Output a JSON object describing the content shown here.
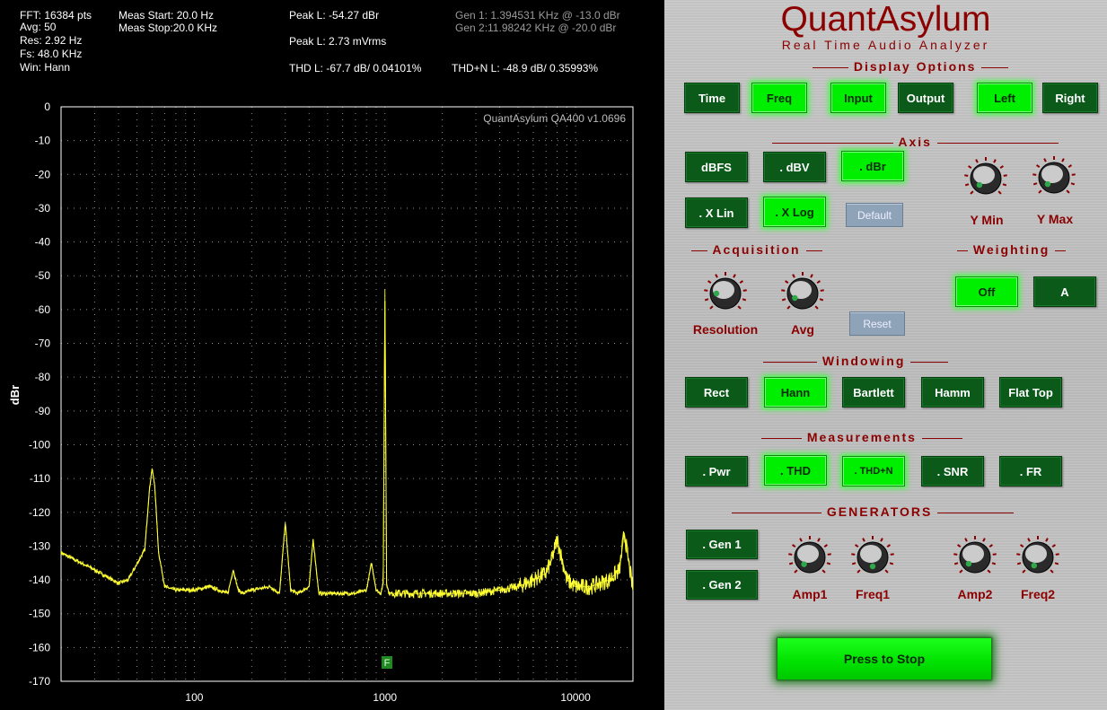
{
  "readouts": {
    "fft": "FFT: 16384 pts",
    "avg": "Avg: 50",
    "res": "Res: 2.92 Hz",
    "fs": "Fs: 48.0 KHz",
    "win": "Win: Hann",
    "meas_start": "Meas Start: 20.0 Hz",
    "meas_stop": "Meas Stop:20.0 KHz",
    "peak_dbr": "Peak L: -54.27 dBr",
    "peak_mv": "Peak L: 2.73 mVrms",
    "thd": "THD L: -67.7 dB/ 0.04101%",
    "thdn": "THD+N L: -48.9 dB/ 0.35993%",
    "gen1": "Gen 1: 1.394531 KHz @ -13.0  dBr",
    "gen2": "Gen 2:11.98242 KHz @ -20.0  dBr"
  },
  "plot": {
    "watermark": "QuantAsylum QA400 v1.0696",
    "marker": "F",
    "colors": {
      "trace": "#ffff33",
      "grid": "#d0d0d0",
      "frame": "#ffffff",
      "marker": "#1f8a1f"
    }
  },
  "chart_data": {
    "type": "line",
    "ylabel": "dBr",
    "xlabel": "",
    "x_scale": "log",
    "xlim": [
      20,
      20000
    ],
    "ylim": [
      -170,
      0
    ],
    "y_ticks": [
      "0",
      "-10",
      "-20",
      "-30",
      "-40",
      "-50",
      "-60",
      "-70",
      "-80",
      "-90",
      "-100",
      "-110",
      "-120",
      "-130",
      "-140",
      "-150",
      "-160",
      "-170"
    ],
    "x_ticks": [
      "100",
      "1000",
      "10000"
    ],
    "grid": true,
    "series": [
      {
        "x": [
          20,
          30,
          40,
          45,
          55,
          58,
          60,
          62,
          65,
          70,
          80,
          100,
          120,
          150,
          160,
          170,
          180,
          200,
          250,
          280,
          300,
          320,
          350,
          400,
          420,
          450,
          500,
          600,
          700,
          800,
          850,
          900,
          950,
          980,
          1000,
          1020,
          1050,
          1100,
          1200,
          1500,
          2000,
          3000,
          4000,
          5000,
          6000,
          7000,
          7500,
          8000,
          8500,
          9000,
          10000,
          12000,
          15000,
          17000,
          18000,
          20000
        ],
        "y": [
          -132,
          -137,
          -141,
          -140,
          -131,
          -114,
          -107,
          -112,
          -132,
          -142,
          -143,
          -143,
          -142,
          -144,
          -137,
          -143,
          -144,
          -143,
          -142,
          -144,
          -123,
          -143,
          -144,
          -142,
          -128,
          -144,
          -144,
          -144,
          -144,
          -143,
          -135,
          -143,
          -144,
          -141,
          -54,
          -141,
          -144,
          -144,
          -144,
          -144,
          -144,
          -144,
          -143,
          -142,
          -140,
          -138,
          -134,
          -128,
          -134,
          -140,
          -142,
          -142,
          -140,
          -137,
          -126,
          -143
        ]
      }
    ]
  },
  "panel": {
    "title": "QuantAsylum",
    "subtitle": "Real Time Audio Analyzer",
    "sections": {
      "display": "Display Options",
      "axis": "Axis",
      "acq": "Acquisition",
      "weight": "Weighting",
      "window": "Windowing",
      "meas": "Measurements",
      "gen": "GENERATORS"
    },
    "buttons": {
      "time": "Time",
      "freq": "Freq",
      "input": "Input",
      "output": "Output",
      "left": "Left",
      "right": "Right",
      "dbfs": "dBFS",
      "dbv": ". dBV",
      "dbr": ". dBr",
      "xlin": ". X Lin",
      "xlog": ". X Log",
      "default": "Default",
      "reset": "Reset",
      "off": "Off",
      "a": "A",
      "rect": "Rect",
      "hann": "Hann",
      "bartlett": "Bartlett",
      "hamm": "Hamm",
      "flattop": "Flat Top",
      "pwr": ". Pwr",
      "thd": ". THD",
      "thdn": ". THD+N",
      "snr": ". SNR",
      "fr": ". FR",
      "gen1": ". Gen 1",
      "gen2": ". Gen 2",
      "stop": "Press to Stop"
    },
    "knobs": {
      "ymin": "Y Min",
      "ymax": "Y Max",
      "resolution": "Resolution",
      "avg": "Avg",
      "amp1": "Amp1",
      "freq1": "Freq1",
      "amp2": "Amp2",
      "freq2": "Freq2"
    }
  }
}
